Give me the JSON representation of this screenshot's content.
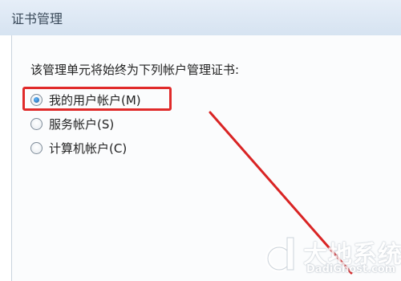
{
  "window": {
    "title": "证书管理"
  },
  "prompt": {
    "text": "该管理单元将始终为下列帐户管理证书:"
  },
  "options": [
    {
      "label": "我的用户帐户(M)",
      "checked": true
    },
    {
      "label": "服务帐户(S)",
      "checked": false
    },
    {
      "label": "计算机帐户(C)",
      "checked": false
    }
  ],
  "watermark": {
    "cn": "大地系统",
    "en": "DadiGhost.com"
  },
  "colors": {
    "highlight": "#e02a2a",
    "arrow": "#d92424"
  }
}
